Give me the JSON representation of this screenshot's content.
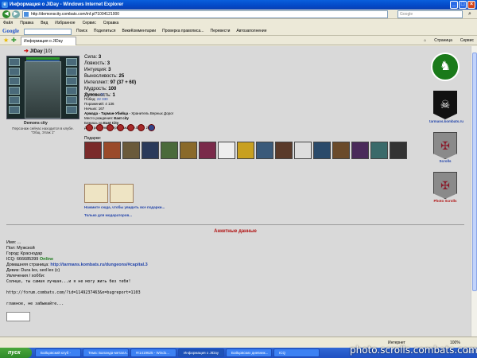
{
  "window": {
    "title": "Информация о JIDay - Windows Internet Explorer"
  },
  "address": {
    "url": "http://demonscity.combats.com/inf.pl?1004121000",
    "search_placeholder": "Google"
  },
  "menu": [
    "Файл",
    "Правка",
    "Вид",
    "Избранное",
    "Сервис",
    "Справка"
  ],
  "toolbar": {
    "items": [
      "Поиск",
      "Поделиться",
      "ВикиКомментарии",
      "Проверка правописа...",
      "Перевести",
      "Автозаполнение"
    ]
  },
  "tab": {
    "label": "Информация о JIDay"
  },
  "right_tools": [
    "Страница",
    "Сервис"
  ],
  "character": {
    "name": "JIDay",
    "level": "[10]",
    "city": "Demons city",
    "location": "Персонаж сейчас находится в клубе. \"Общ. Этаж 1\"",
    "stats": [
      {
        "label": "Сила:",
        "value": "3"
      },
      {
        "label": "Ловкость:",
        "value": "3"
      },
      {
        "label": "Интуиция:",
        "value": "3"
      },
      {
        "label": "Выносливость:",
        "value": "25"
      },
      {
        "label": "Интеллект:",
        "value": "97 (37 + 60)"
      },
      {
        "label": "Мудрость:",
        "value": "100"
      },
      {
        "label": "Духовность:",
        "value": "1"
      }
    ],
    "info": [
      {
        "label": "Уровень:",
        "value": "10"
      },
      {
        "label": "Побед:",
        "value": "22 330"
      },
      {
        "label": "Поражений:",
        "value": "4 136"
      },
      {
        "label": "Ничьих:",
        "value": "167"
      },
      {
        "label": "Армада - Тарман-Убийца -",
        "value": "Хранитель Верных Дорог"
      },
      {
        "label": "Место рождения:",
        "value": "East city"
      },
      {
        "label": "Бежишь из",
        "value": "East City"
      },
      {
        "label": "День рождения персонажа:",
        "value": "09.03.04 20:43"
      }
    ]
  },
  "gifts": {
    "label": "Подарки:",
    "count": 17,
    "more_link": "Нажмите сюда, чтобы увидеть все подарки...",
    "mod_link": "Только для модераторов..."
  },
  "right_column": {
    "tarmans_label": "tarmans.kombats.ru",
    "scrolls_label": "Scrolls",
    "photo_scrolls_label": "Photo Scrolls"
  },
  "anketa": {
    "title": "Анкетные данные",
    "lines": {
      "name": "Имя: ...",
      "gender": "Пол: Мужской",
      "city": "Город: Краснодар",
      "icq_label": "ICQ: 666685399",
      "icq_status": "Online",
      "homepage_label": "Домашняя страница:",
      "homepage_link": "http://tarmans.kombats.ru/dungeons/#capital.3",
      "motto": "Девиз: Dura lex, sed lex (с)",
      "hobby_label": "Увлечения / хобби:",
      "hobby": "Солнце, ты самая лучшая...и я не могу жить без тебя!",
      "forum_link": "http://forum.combats.com/?id=1149237463&n=bugreport=1103",
      "closing": "главное, не забывайте..."
    }
  },
  "statusbar": {
    "zone": "Интернет",
    "zoom": "100%"
  },
  "taskbar": {
    "start": "пуск",
    "tasks": [
      "Бойцовский клуб -",
      "Тема: Баланда-металл...",
      "#r1419625 - Windo...",
      "Информация о JIDay",
      "Бойцовских диевник...",
      "ICQ"
    ],
    "clock": "0:55"
  },
  "watermark": "photo.scrolls.combats.com"
}
